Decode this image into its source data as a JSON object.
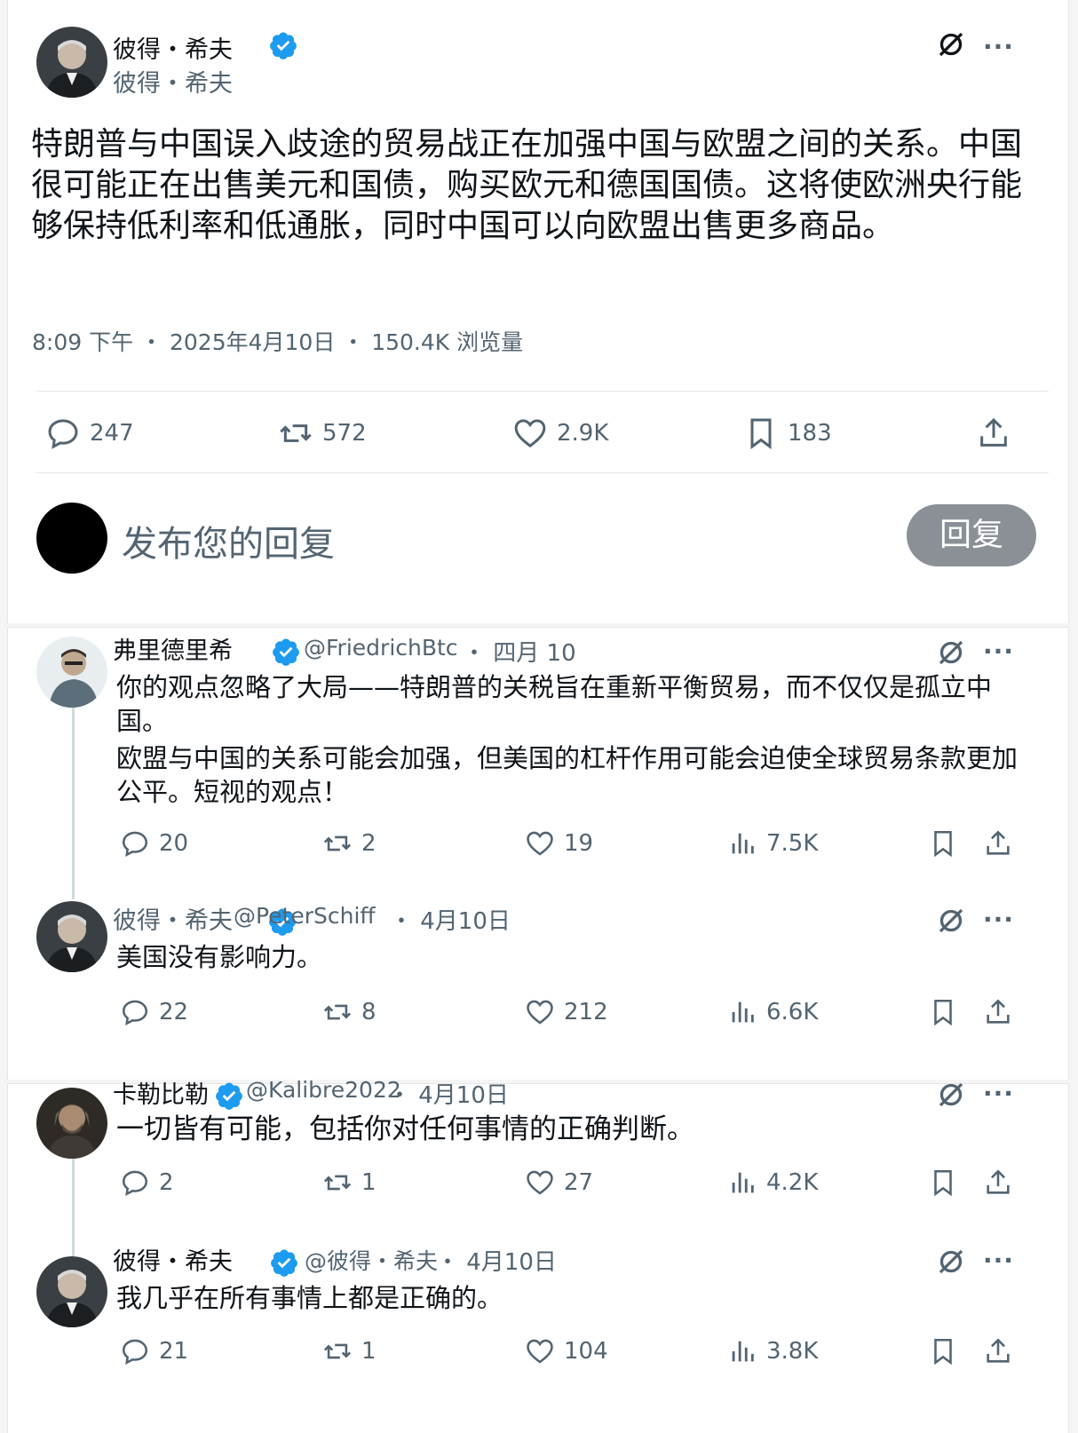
{
  "main_post": {
    "author_name": "彼得・希夫",
    "author_handle": "彼得・希夫",
    "text": "特朗普与中国误入歧途的贸易战正在加强中国与欧盟之间的关系。中国很可能正在出售美元和国债，购买欧元和德国国债。这将使欧洲央行能够保持低利率和低通胀，同时中国可以向欧盟出售更多商品。",
    "timestamp": "8:09 下午 ・ 2025年4月10日 ・ 150.4K 浏览量",
    "replies": "247",
    "reposts": "572",
    "likes": "2.9K",
    "bookmarks": "183"
  },
  "reply_box": {
    "placeholder": "发布您的回复",
    "button_label": "回复"
  },
  "replies": [
    {
      "author_name": "弗里德里希",
      "handle": "@FriedrichBtc",
      "date": "・ 四月 10",
      "paragraphs": [
        "你的观点忽略了大局——特朗普的关税旨在重新平衡贸易，而不仅仅是孤立中国。",
        "欧盟与中国的关系可能会加强，但美国的杠杆作用可能会迫使全球贸易条款更加公平。短视的观点！"
      ],
      "replies": "20",
      "reposts": "2",
      "likes": "19",
      "views": "7.5K"
    },
    {
      "author_name": "彼得・希夫",
      "handle": "@PeterSchiff",
      "date": "・ 4月10日",
      "paragraphs": [
        "美国没有影响力。"
      ],
      "replies": "22",
      "reposts": "8",
      "likes": "212",
      "views": "6.6K"
    },
    {
      "author_name": "卡勒比勒",
      "handle": "@Kalibre2022",
      "date": "・ 4月10日",
      "paragraphs": [
        "一切皆有可能，包括你对任何事情的正确判断。"
      ],
      "replies": "2",
      "reposts": "1",
      "likes": "27",
      "views": "4.2K"
    },
    {
      "author_name": "彼得・希夫",
      "handle": "@彼得・希夫",
      "date": "・ 4月10日",
      "paragraphs": [
        "我几乎在所有事情上都是正确的。"
      ],
      "replies": "21",
      "reposts": "1",
      "likes": "104",
      "views": "3.8K"
    }
  ],
  "icons": {
    "verified": "verified-badge-icon",
    "grok": "grok-icon",
    "more": "more-icon",
    "reply": "reply-icon",
    "repost": "repost-icon",
    "like": "like-icon",
    "bookmark": "bookmark-icon",
    "share": "share-icon",
    "views": "views-icon"
  },
  "more_symbol": "···",
  "colors": {
    "verified": "#1d9bf0",
    "secondary_text": "#536471",
    "reply_button": "#8a9096"
  }
}
